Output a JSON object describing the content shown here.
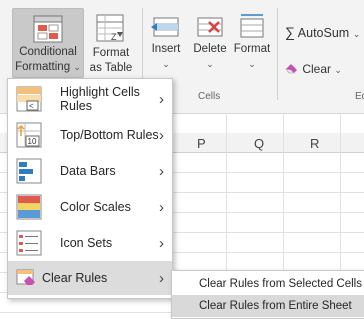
{
  "ribbon": {
    "conditional_formatting": {
      "line1": "Conditional",
      "line2": "Formatting"
    },
    "format_as_table": {
      "line1": "Format",
      "line2": "as Table"
    },
    "insert": "Insert",
    "delete": "Delete",
    "format": "Format",
    "cells_group_label": "Cells",
    "autosum": "AutoSum",
    "clear": "Clear",
    "editing_group_label": "Ed"
  },
  "grid": {
    "columns": [
      "P",
      "Q",
      "R"
    ]
  },
  "menu": {
    "items": [
      {
        "label": "Highlight Cells Rules",
        "icon": "highlight-cells-icon"
      },
      {
        "label": "Top/Bottom Rules",
        "icon": "top-bottom-icon"
      },
      {
        "label": "Data Bars",
        "icon": "data-bars-icon"
      },
      {
        "label": "Color Scales",
        "icon": "color-scales-icon"
      },
      {
        "label": "Icon Sets",
        "icon": "icon-sets-icon"
      },
      {
        "label": "Clear Rules",
        "icon": "clear-rules-icon"
      }
    ]
  },
  "submenu": {
    "items": [
      {
        "label": "Clear Rules from Selected Cells"
      },
      {
        "label": "Clear Rules from Entire Sheet"
      }
    ]
  },
  "colors": {
    "accent": "#217346",
    "menu_hover": "#dcdcdc",
    "ribbon_bg": "#f3f3f3"
  }
}
